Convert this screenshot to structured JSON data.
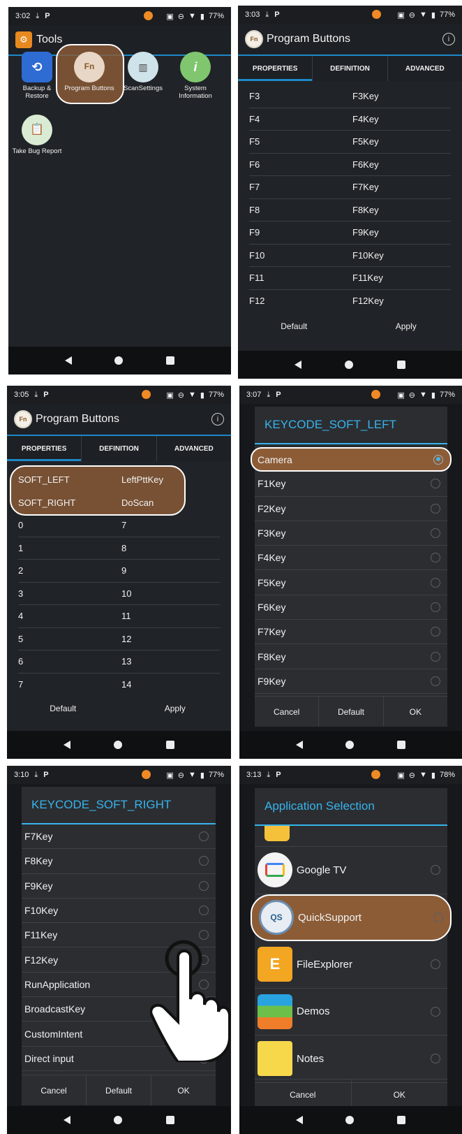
{
  "colors": {
    "accent": "#37b4ec",
    "tab_accent": "#1e88c8",
    "highlight": "#8c5c37",
    "orange_dot": "#f08a24"
  },
  "status_icons": [
    "download-icon",
    "p-icon",
    "scan-icon",
    "dnd-icon",
    "wifi-icon",
    "battery-icon"
  ],
  "panel1": {
    "time": "3:02",
    "battery": "77%",
    "title": "Tools",
    "tools": [
      {
        "label_line1": "Backup &",
        "label_line2": "Restore",
        "icon": "backup-icon"
      },
      {
        "label_line1": "Program Buttons",
        "label_line2": "",
        "icon": "fn-icon"
      },
      {
        "label_line1": "ScanSettings",
        "label_line2": "",
        "icon": "barcode-icon"
      },
      {
        "label_line1": "System",
        "label_line2": "Information",
        "icon": "info-icon"
      },
      {
        "label_line1": "Take Bug Report",
        "label_line2": "",
        "icon": "clipboard-icon"
      }
    ]
  },
  "panel2": {
    "time": "3:03",
    "battery": "77%",
    "title": "Program Buttons",
    "tabs": [
      "PROPERTIES",
      "DEFINITION",
      "ADVANCED"
    ],
    "rows": [
      [
        "F3",
        "F3Key"
      ],
      [
        "F4",
        "F4Key"
      ],
      [
        "F5",
        "F5Key"
      ],
      [
        "F6",
        "F6Key"
      ],
      [
        "F7",
        "F7Key"
      ],
      [
        "F8",
        "F8Key"
      ],
      [
        "F9",
        "F9Key"
      ],
      [
        "F10",
        "F10Key"
      ],
      [
        "F11",
        "F11Key"
      ],
      [
        "F12",
        "F12Key"
      ]
    ],
    "default_label": "Default",
    "apply_label": "Apply"
  },
  "panel3": {
    "time": "3:05",
    "battery": "77%",
    "title": "Program Buttons",
    "tabs": [
      "PROPERTIES",
      "DEFINITION",
      "ADVANCED"
    ],
    "rows": [
      [
        "SOFT_LEFT",
        "LeftPttKey"
      ],
      [
        "SOFT_RIGHT",
        "DoScan"
      ],
      [
        "0",
        "7"
      ],
      [
        "1",
        "8"
      ],
      [
        "2",
        "9"
      ],
      [
        "3",
        "10"
      ],
      [
        "4",
        "11"
      ],
      [
        "5",
        "12"
      ],
      [
        "6",
        "13"
      ],
      [
        "7",
        "14"
      ]
    ],
    "default_label": "Default",
    "apply_label": "Apply"
  },
  "panel4": {
    "time": "3:07",
    "battery": "77%",
    "dialog_title": "KEYCODE_SOFT_LEFT",
    "options": [
      "Camera",
      "F1Key",
      "F2Key",
      "F3Key",
      "F4Key",
      "F5Key",
      "F6Key",
      "F7Key",
      "F8Key",
      "F9Key"
    ],
    "selected_index": 0,
    "buttons": [
      "Cancel",
      "Default",
      "OK"
    ]
  },
  "panel5": {
    "time": "3:10",
    "battery": "77%",
    "dialog_title": "KEYCODE_SOFT_RIGHT",
    "options": [
      "F7Key",
      "F8Key",
      "F9Key",
      "F10Key",
      "F11Key",
      "F12Key",
      "RunApplication",
      "BroadcastKey",
      "CustomIntent",
      "Direct input"
    ],
    "buttons": [
      "Cancel",
      "Default",
      "OK"
    ]
  },
  "panel6": {
    "time": "3:13",
    "battery": "78%",
    "dialog_title": "Application Selection",
    "apps": [
      {
        "name": "Google TV",
        "icon": "google-tv-icon"
      },
      {
        "name": "QuickSupport",
        "icon": "quicksupport-icon"
      },
      {
        "name": "FileExplorer",
        "icon": "file-explorer-icon"
      },
      {
        "name": "Demos",
        "icon": "demos-icon"
      },
      {
        "name": "Notes",
        "icon": "notes-icon"
      }
    ],
    "buttons": [
      "Cancel",
      "OK"
    ]
  }
}
